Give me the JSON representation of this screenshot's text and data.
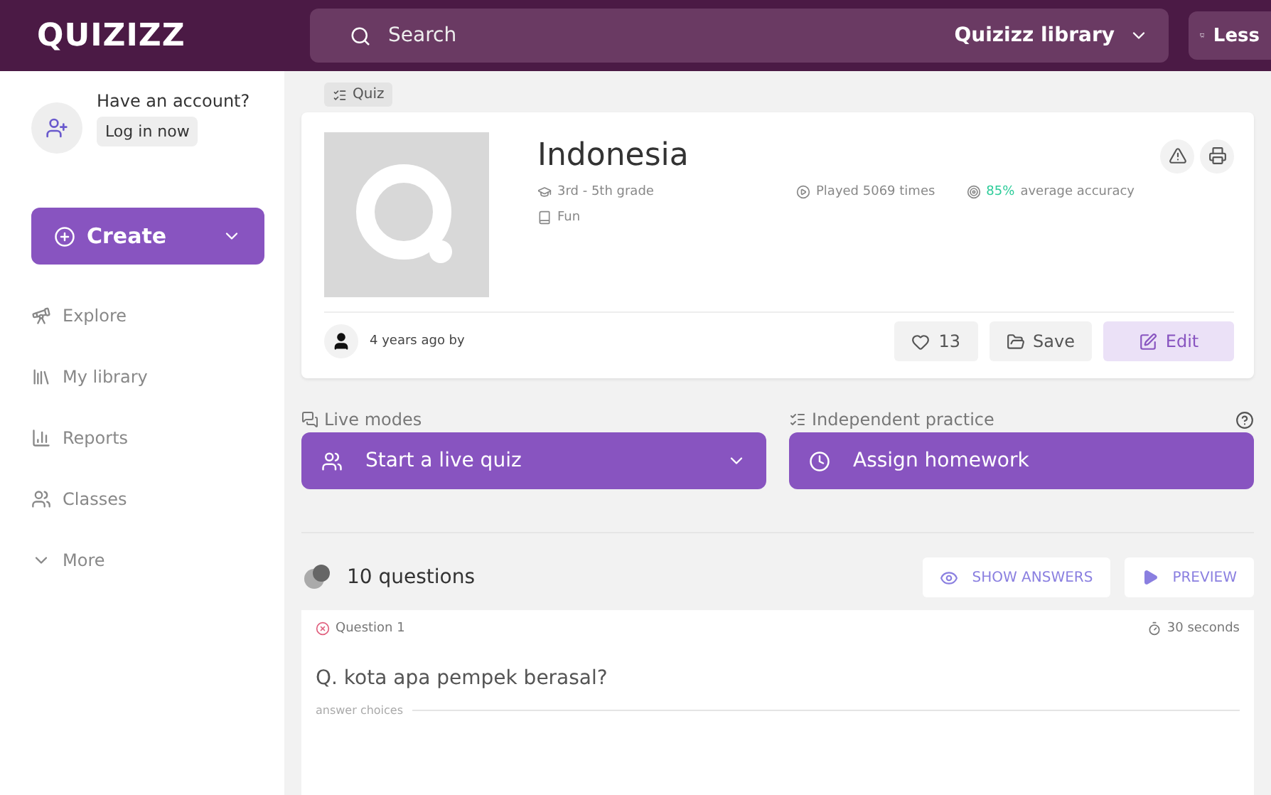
{
  "header": {
    "logo": "QUIZIZZ",
    "search": {
      "placeholder": "Search"
    },
    "library_select": "Quizizz library",
    "lessons_button": "Less"
  },
  "sidebar": {
    "account_prompt": "Have an account?",
    "login_button": "Log in now",
    "create_button": "Create",
    "items": [
      {
        "label": "Explore"
      },
      {
        "label": "My library"
      },
      {
        "label": "Reports"
      },
      {
        "label": "Classes"
      },
      {
        "label": "More"
      }
    ]
  },
  "quiz": {
    "type_tag": "Quiz",
    "title": "Indonesia",
    "grade": "3rd - 5th grade",
    "played": "Played 5069 times",
    "accuracy_value": "85%",
    "accuracy_label": "average accuracy",
    "subject": "Fun",
    "author_note": "4 years ago by",
    "likes": "13",
    "save_button": "Save",
    "edit_button": "Edit"
  },
  "modes": {
    "live_label": "Live modes",
    "live_button": "Start a live quiz",
    "practice_label": "Independent practice",
    "practice_button": "Assign homework"
  },
  "questions": {
    "count": "10 questions",
    "show_answers": "SHOW ANSWERS",
    "preview": "PREVIEW",
    "items": [
      {
        "number": "Question 1",
        "time": "30 seconds",
        "text": "Q. kota apa pempek berasal?",
        "choices_label": "answer choices"
      }
    ]
  }
}
